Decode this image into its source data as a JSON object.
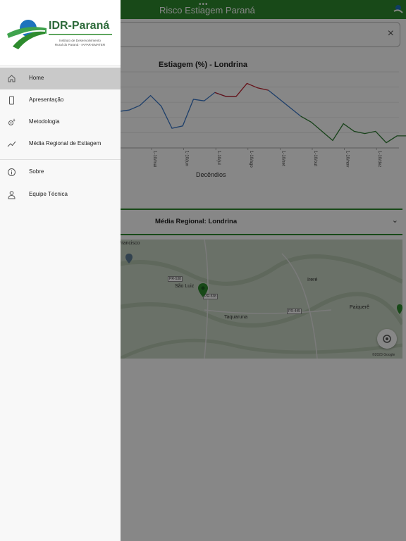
{
  "app": {
    "title": "Risco Estiagem Paraná",
    "dots": "•••"
  },
  "search": {
    "clear_glyph": "×"
  },
  "chart_data": {
    "type": "line",
    "title": "Estiagem (%) - Londrina",
    "xlabel": "Decêndios",
    "ylabel": "",
    "tick_labels": [
      "1-10/mai",
      "1-10/jun",
      "1-10/jul",
      "1-10/ago",
      "1-10/set",
      "1-10/out",
      "1-10/nov",
      "1-10/dez"
    ],
    "series": [
      {
        "color": "#3a77c8",
        "values": [
          46,
          48,
          54,
          67,
          53,
          24,
          27,
          62,
          60,
          71,
          66,
          66
        ]
      },
      {
        "color": "#c0202e",
        "values": [
          null,
          null,
          null,
          null,
          null,
          null,
          null,
          null,
          null,
          71,
          66,
          66,
          83,
          77,
          74
        ]
      },
      {
        "color": "#2e7d32",
        "values": [
          null,
          null,
          null,
          null,
          null,
          null,
          null,
          null,
          null,
          null,
          null,
          null,
          null,
          null,
          null,
          null,
          null,
          40,
          32,
          20,
          8,
          30,
          20,
          17,
          20,
          5,
          14,
          14
        ]
      }
    ],
    "blue_tail": [
      74,
      40
    ],
    "grid": true
  },
  "accordion": {
    "title": "Média Regional: Londrina",
    "chevron": "⌄"
  },
  "map": {
    "places": [
      "Francisco",
      "São Luiz",
      "Ireré",
      "Taquaruna",
      "Paiquerê"
    ],
    "roads": [
      "PR-538",
      "PR-538",
      "PR-445"
    ],
    "copyright": "©2023 Google"
  },
  "drawer": {
    "brand": "IDR-Paraná",
    "subtitle_1": "Instituto de Desenvolvimento",
    "subtitle_2": "Rural do Paraná - IAPAR-EMATER",
    "items": [
      {
        "label": "Home",
        "icon": "home-icon"
      },
      {
        "label": "Apresentação",
        "icon": "phone-icon"
      },
      {
        "label": "Metodologia",
        "icon": "gear-sparkle-icon"
      },
      {
        "label": "Média Regional de Estiagem",
        "icon": "trending-icon"
      },
      {
        "label": "Sobre",
        "icon": "info-icon"
      },
      {
        "label": "Equipe Técnica",
        "icon": "person-icon"
      }
    ]
  },
  "colors": {
    "primary_green": "#2e8b2e",
    "brand_dark": "#2d6a3a",
    "brand_blue": "#1e73be"
  }
}
